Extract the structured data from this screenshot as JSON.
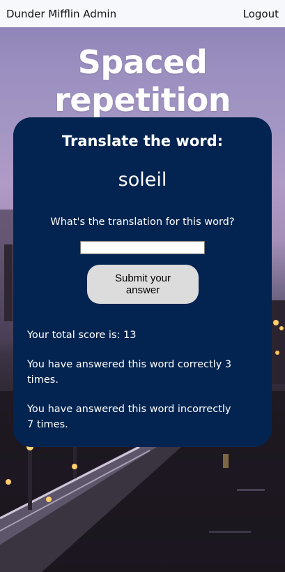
{
  "nav": {
    "brand": "Dunder Mifflin Admin",
    "logout": "Logout"
  },
  "page": {
    "title": "Spaced repetition"
  },
  "card": {
    "heading": "Translate the word:",
    "word": "soleil",
    "prompt": "What's the translation for this word?",
    "input": {
      "value": "",
      "placeholder": ""
    },
    "submit_label": "Submit your answer",
    "score_text": "Your total score is: 13",
    "correct_text": "You have answered this word correctly 3 times.",
    "incorrect_text": "You have answered this word incorrectly 7 times."
  },
  "colors": {
    "card_background": "#032450",
    "topbar_background": "#f7f8fb",
    "button_background": "#dcdcdc"
  }
}
